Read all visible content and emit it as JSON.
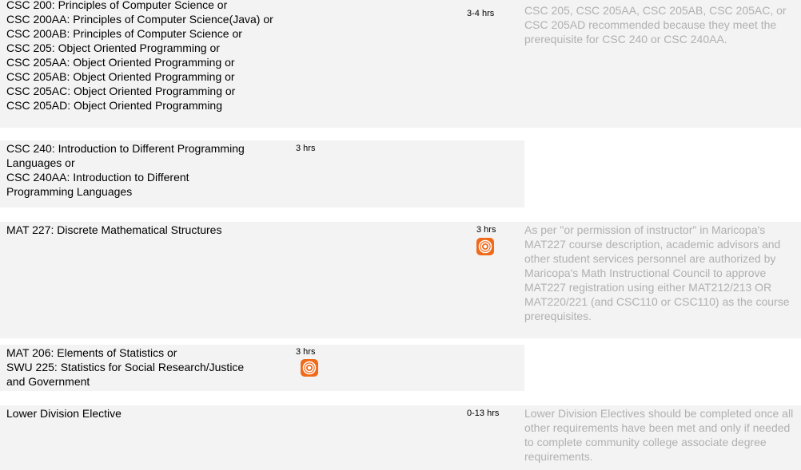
{
  "rows": [
    {
      "courses": [
        "CSC 200: Principles of Computer Science or",
        "CSC 200AA: Principles of Computer Science(Java) or",
        "CSC 200AB: Principles of Computer Science or",
        "CSC 205: Object Oriented Programming or",
        "CSC 205AA: Object Oriented Programming or",
        "CSC 205AB: Object Oriented Programming or",
        "CSC 205AC: Object Oriented Programming or",
        "CSC 205AD: Object Oriented Programming"
      ],
      "hours": "3-4 hrs",
      "note": "CSC 205, CSC 205AA, CSC 205AB, CSC 205AC, or CSC 205AD recommended because they meet the prerequisite for CSC 240 or CSC 240AA."
    },
    {
      "courses": [
        "CSC 240: Introduction to Different Programming Languages or",
        "CSC 240AA: Introduction to Different Programming Languages"
      ],
      "hours": "3 hrs",
      "note": ""
    },
    {
      "courses": [
        "MAT 227: Discrete Mathematical Structures"
      ],
      "hours": "3 hrs",
      "badge_icon": "orange-circle-badge-icon",
      "note": "As per \"or permission of instructor\" in Maricopa's MAT227 course description, academic advisors and other student services personnel are authorized by Maricopa's Math Instructional Council to approve MAT227 registration using either MAT212/213 OR MAT220/221 (and CSC110 or CSC110) as the course prerequisites."
    },
    {
      "courses": [
        "MAT 206: Elements of Statistics or",
        "SWU 225: Statistics for Social Research/Justice and Government"
      ],
      "hours": "3 hrs",
      "badge_icon": "orange-circle-badge-icon",
      "note": ""
    },
    {
      "courses": [
        "Lower Division Elective"
      ],
      "hours": "0-13 hrs",
      "note": "Lower Division Electives should be completed once all other requirements have been met and only if needed to complete community college associate degree requirements."
    }
  ],
  "colors": {
    "row_background": "#f3f3f3",
    "note_text": "#b0b0b0",
    "badge": "#f06a1a"
  }
}
